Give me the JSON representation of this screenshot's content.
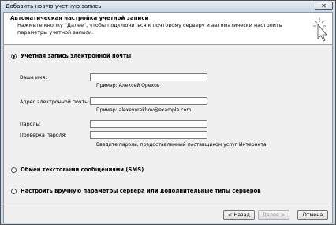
{
  "window": {
    "title": "Добавить новую учетную запись",
    "close_glyph": "✕"
  },
  "header": {
    "title": "Автоматическая настройка учетной записи",
    "description": "Нажмите кнопку \"Далее\", чтобы подключиться к почтовому серверу и автоматически настроить параметры учетной записи."
  },
  "options": {
    "email_account": {
      "label": "Учетная запись электронной почты",
      "selected": true
    },
    "sms": {
      "label": "Обмен текстовыми сообщениями (SMS)",
      "selected": false
    },
    "manual": {
      "label": "Настроить вручную параметры сервера или дополнительные типы серверов",
      "selected": false
    }
  },
  "form": {
    "name": {
      "label": "Ваше имя:",
      "value": "",
      "hint": "Пример: Алексей Орехов"
    },
    "email": {
      "label": "Адрес электронной почты:",
      "value": "",
      "hint": "Пример: alexeyorekhov@example.com"
    },
    "password": {
      "label": "Пароль:",
      "value": ""
    },
    "password_confirm": {
      "label": "Проверка пароля:",
      "value": "",
      "hint": "Введите пароль, предоставленный поставщиком услуг Интернета."
    }
  },
  "buttons": {
    "back": "< Назад",
    "next": "Далее >",
    "cancel": "Отмена"
  }
}
